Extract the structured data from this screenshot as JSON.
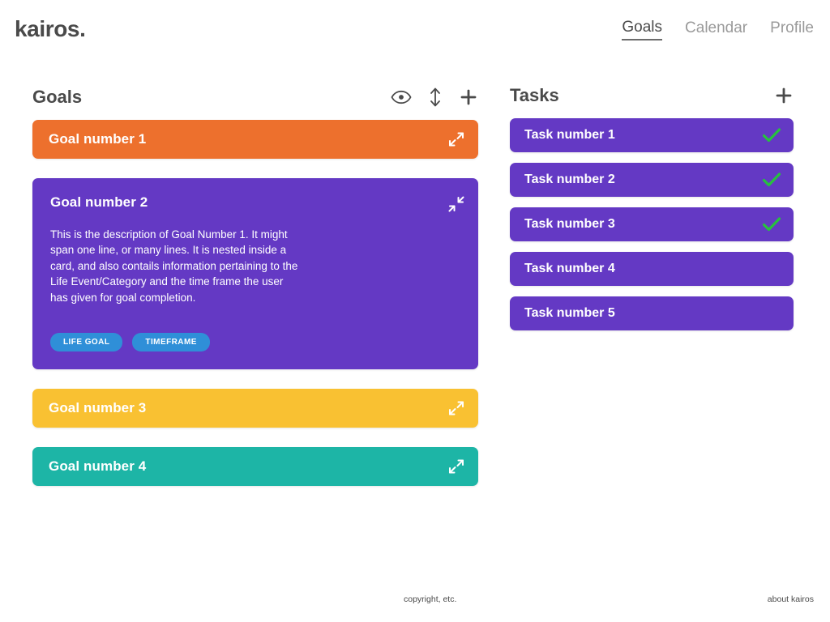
{
  "header": {
    "logo": "kairos.",
    "nav": [
      {
        "label": "Goals",
        "active": true
      },
      {
        "label": "Calendar",
        "active": false
      },
      {
        "label": "Profile",
        "active": false
      }
    ]
  },
  "goals_panel": {
    "title": "Goals",
    "actions": [
      {
        "name": "eye-icon",
        "label": "Toggle visibility"
      },
      {
        "name": "sort-icon",
        "label": "Sort goals"
      },
      {
        "name": "plus-icon",
        "label": "Add goal"
      }
    ],
    "cards": [
      {
        "title": "Goal number 1",
        "color": "#ED702D",
        "expanded": false,
        "toggle_icon": "expand-icon"
      },
      {
        "title": "Goal number 2",
        "color": "#6439C4",
        "expanded": true,
        "toggle_icon": "collapse-icon",
        "description": "This is the description of Goal Number 1. It might span one line, or many lines. It is nested inside a card, and also contails information pertaining to the Life Event/Category and the time frame the user has given for goal completion.",
        "badges": [
          "LIFE GOAL",
          "TIMEFRAME"
        ],
        "badge_color": "#2F8FD8"
      },
      {
        "title": "Goal number 3",
        "color": "#F9C132",
        "expanded": false,
        "toggle_icon": "expand-icon"
      },
      {
        "title": "Goal number 4",
        "color": "#1DB5A6",
        "expanded": false,
        "toggle_icon": "expand-icon"
      }
    ]
  },
  "tasks_panel": {
    "title": "Tasks",
    "add_action": {
      "name": "plus-icon",
      "label": "Add task"
    },
    "card_color": "#6439C4",
    "check_color": "#27C13E",
    "cards": [
      {
        "title": "Task number 1",
        "done": true
      },
      {
        "title": "Task number 2",
        "done": true
      },
      {
        "title": "Task number 3",
        "done": true
      },
      {
        "title": "Task number 4",
        "done": false
      },
      {
        "title": "Task number 5",
        "done": false
      }
    ]
  },
  "footer": {
    "copyright": "copyright, etc.",
    "about": "about kairos"
  }
}
